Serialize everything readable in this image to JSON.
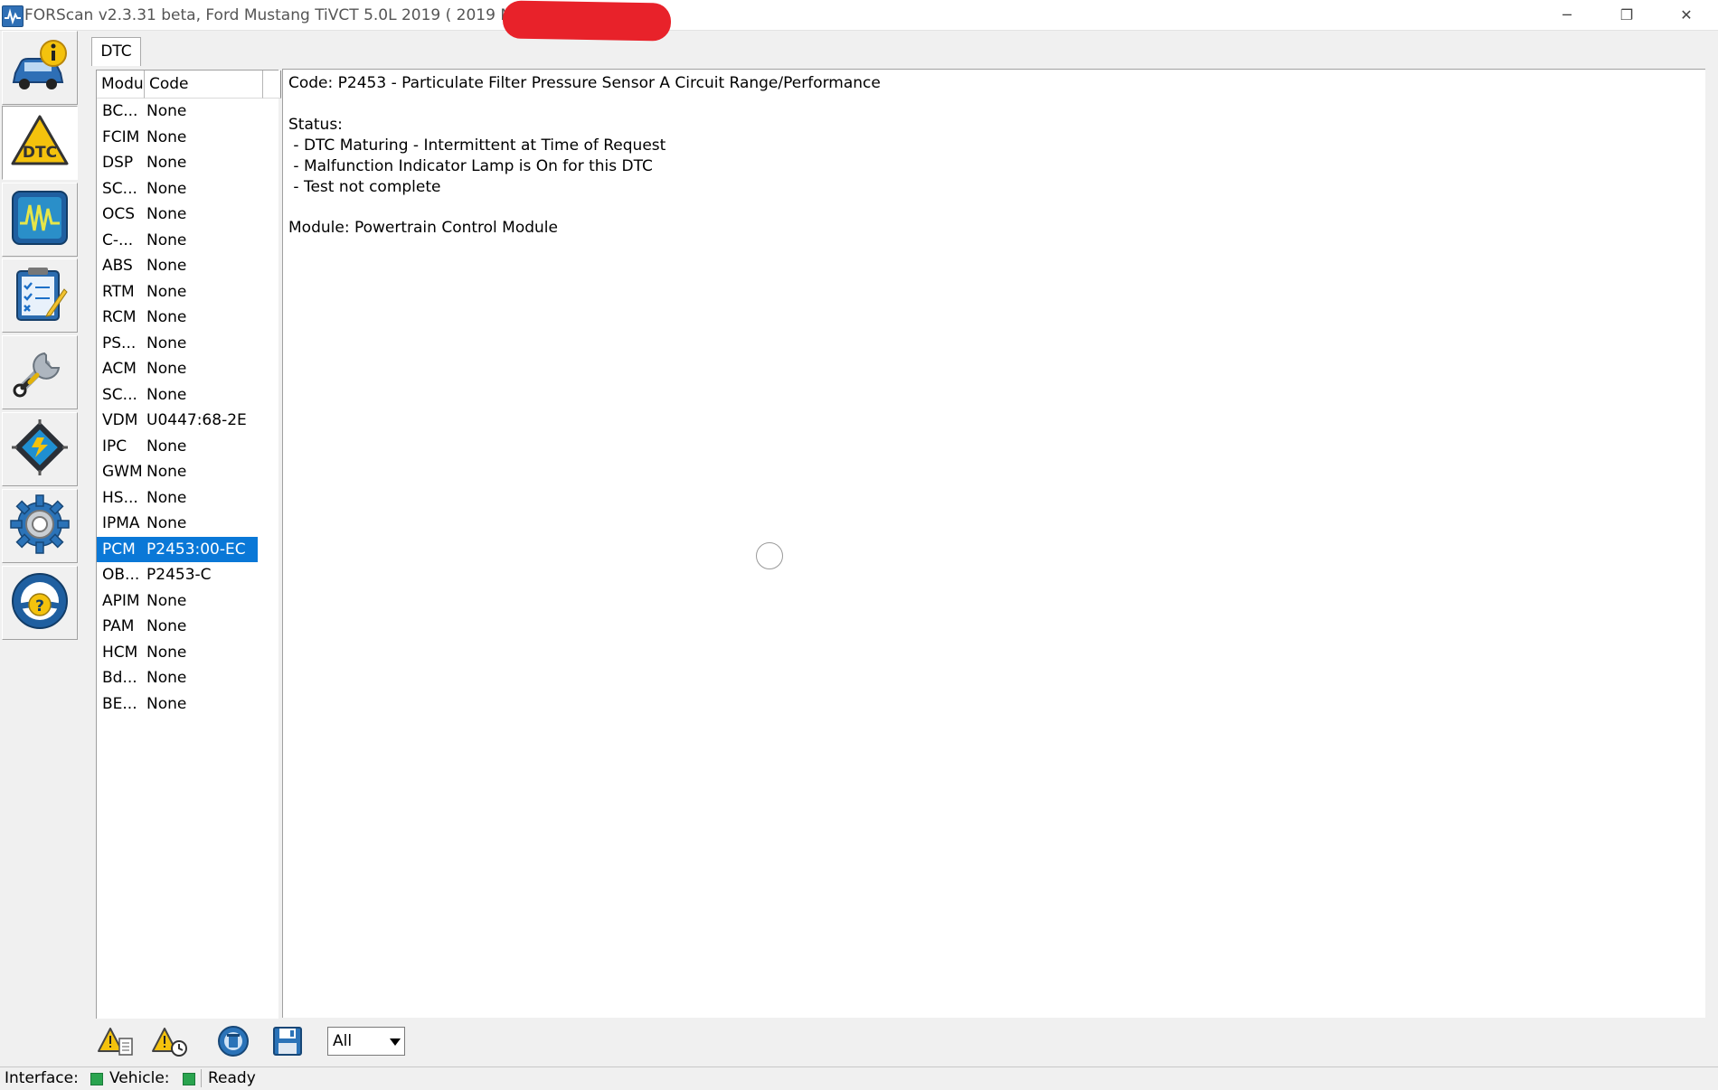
{
  "window": {
    "title": "FORScan v2.3.31 beta, Ford Mustang TiVCT 5.0L 2019 ( 2019 MY ), VIN:",
    "minimize_label": "─",
    "restore_label": "❐",
    "close_label": "✕"
  },
  "sidebar": {
    "items": [
      {
        "name": "vehicle-info",
        "icon": "car-info-icon"
      },
      {
        "name": "dtc",
        "icon": "dtc-warning-icon",
        "active": true
      },
      {
        "name": "live-data",
        "icon": "oscilloscope-icon"
      },
      {
        "name": "tests",
        "icon": "checklist-icon"
      },
      {
        "name": "service",
        "icon": "wrench-icon"
      },
      {
        "name": "configuration",
        "icon": "chip-icon"
      },
      {
        "name": "settings",
        "icon": "gear-icon"
      },
      {
        "name": "help",
        "icon": "help-steering-icon"
      }
    ]
  },
  "tab": {
    "label": "DTC"
  },
  "dtc_list": {
    "headers": {
      "module": "Modu",
      "code": "Code"
    },
    "rows": [
      {
        "module": "BC...",
        "code": "None"
      },
      {
        "module": "FCIM",
        "code": "None"
      },
      {
        "module": "DSP",
        "code": "None"
      },
      {
        "module": "SC...",
        "code": "None"
      },
      {
        "module": "OCS",
        "code": "None"
      },
      {
        "module": "C-...",
        "code": "None"
      },
      {
        "module": "ABS",
        "code": "None"
      },
      {
        "module": "RTM",
        "code": "None"
      },
      {
        "module": "RCM",
        "code": "None"
      },
      {
        "module": "PS...",
        "code": "None"
      },
      {
        "module": "ACM",
        "code": "None"
      },
      {
        "module": "SC...",
        "code": "None"
      },
      {
        "module": "VDM",
        "code": "U0447:68-2E"
      },
      {
        "module": "IPC",
        "code": "None"
      },
      {
        "module": "GWM",
        "code": "None"
      },
      {
        "module": "HS...",
        "code": "None"
      },
      {
        "module": "IPMA",
        "code": "None"
      },
      {
        "module": "PCM",
        "code": "P2453:00-EC",
        "selected": true
      },
      {
        "module": "OB...",
        "code": "P2453-C"
      },
      {
        "module": "APIM",
        "code": "None"
      },
      {
        "module": "PAM",
        "code": "None"
      },
      {
        "module": "HCM",
        "code": "None"
      },
      {
        "module": "Bd...",
        "code": "None"
      },
      {
        "module": "BE...",
        "code": "None"
      }
    ]
  },
  "detail": {
    "code_line": "Code: P2453 - Particulate Filter Pressure Sensor A Circuit Range/Performance",
    "status_label": "Status:",
    "status_items": [
      " - DTC Maturing - Intermittent at Time of Request",
      " - Malfunction Indicator Lamp is On for this DTC",
      " - Test not complete"
    ],
    "module_line": "Module: Powertrain Control Module"
  },
  "toolbar": {
    "buttons": [
      {
        "name": "show-freeze-frame-button",
        "icon": "warning-doc-icon"
      },
      {
        "name": "read-dtc-button",
        "icon": "warning-refresh-icon"
      },
      {
        "name": "clear-dtc-button",
        "icon": "erase-icon"
      },
      {
        "name": "save-button",
        "icon": "floppy-disk-icon"
      }
    ],
    "filter_value": "All"
  },
  "statusbar": {
    "interface_label": "Interface:",
    "vehicle_label": "Vehicle:",
    "status_text": "Ready",
    "led_color": "#2aa44f"
  }
}
